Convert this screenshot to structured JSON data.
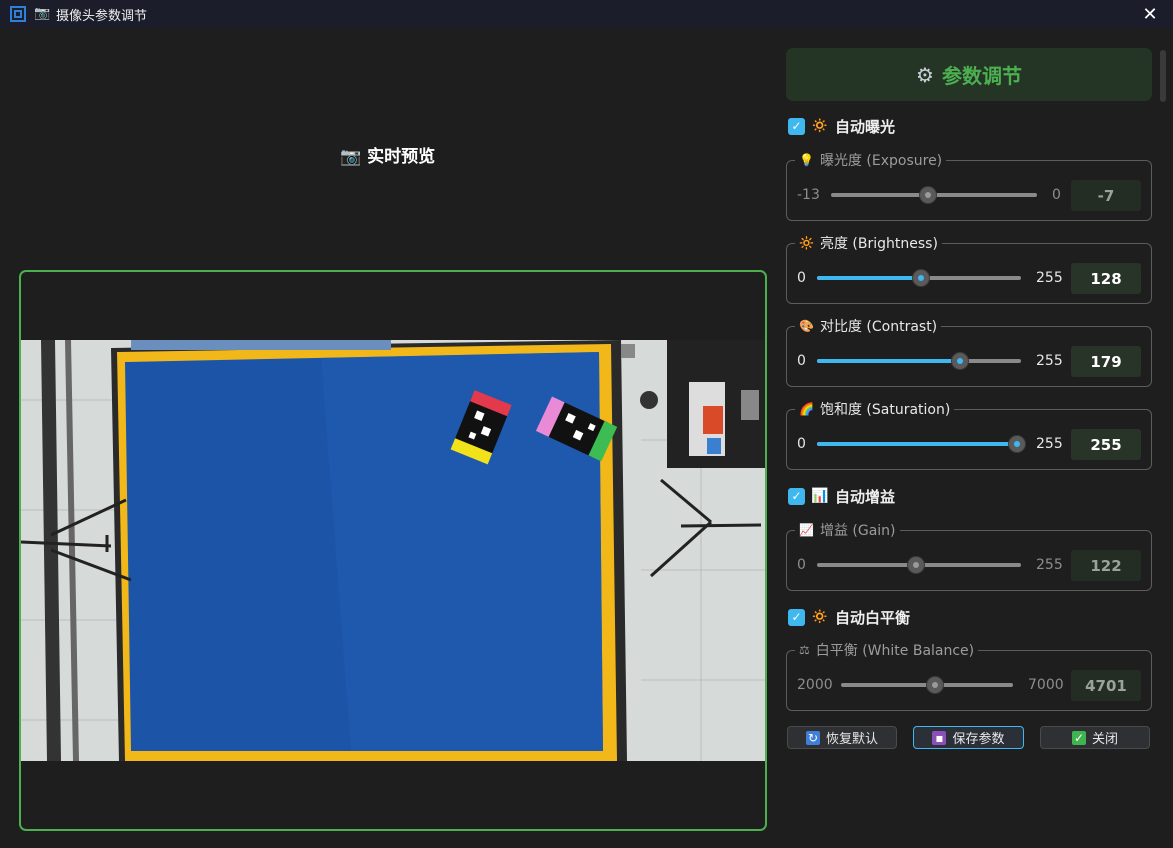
{
  "window": {
    "title": "摄像头参数调节",
    "camera_icon": "📷",
    "close_label": "✕"
  },
  "preview": {
    "title": "📷 实时预览"
  },
  "panel": {
    "gear_icon": "⚙",
    "title": "参数调节"
  },
  "auto_exposure": {
    "checked": true,
    "icon": "🔅",
    "label": "自动曝光"
  },
  "exposure": {
    "icon": "💡",
    "label": "曝光度 (Exposure)",
    "min": "-13",
    "max": "0",
    "value": "-7",
    "fraction": 0.46,
    "enabled": false
  },
  "brightness": {
    "icon": "🔆",
    "label": "亮度 (Brightness)",
    "min": "0",
    "max": "255",
    "value": "128",
    "fraction": 0.502,
    "enabled": true
  },
  "contrast": {
    "icon": "🎨",
    "label": "对比度 (Contrast)",
    "min": "0",
    "max": "255",
    "value": "179",
    "fraction": 0.702,
    "enabled": true
  },
  "saturation": {
    "icon": "🌈",
    "label": "饱和度 (Saturation)",
    "min": "0",
    "max": "255",
    "value": "255",
    "fraction": 1.0,
    "enabled": true
  },
  "auto_gain": {
    "checked": true,
    "icon": "📊",
    "label": "自动增益"
  },
  "gain": {
    "icon": "📈",
    "label": "增益 (Gain)",
    "min": "0",
    "max": "255",
    "value": "122",
    "fraction": 0.478,
    "enabled": false
  },
  "auto_wb": {
    "checked": true,
    "icon": "🔅",
    "label": "自动白平衡"
  },
  "white_balance": {
    "icon": "⚖",
    "label": "白平衡 (White Balance)",
    "min": "2000",
    "max": "7000",
    "value": "4701",
    "fraction": 0.54,
    "enabled": false
  },
  "buttons": {
    "reset": {
      "icon": "🔄",
      "label": "恢复默认"
    },
    "save": {
      "icon": "💾",
      "label": "保存参数"
    },
    "close": {
      "icon": "✅",
      "label": "关闭"
    }
  },
  "colors": {
    "accent": "#3fb8f0",
    "green": "#4caf50",
    "background": "#1e1e1e"
  }
}
